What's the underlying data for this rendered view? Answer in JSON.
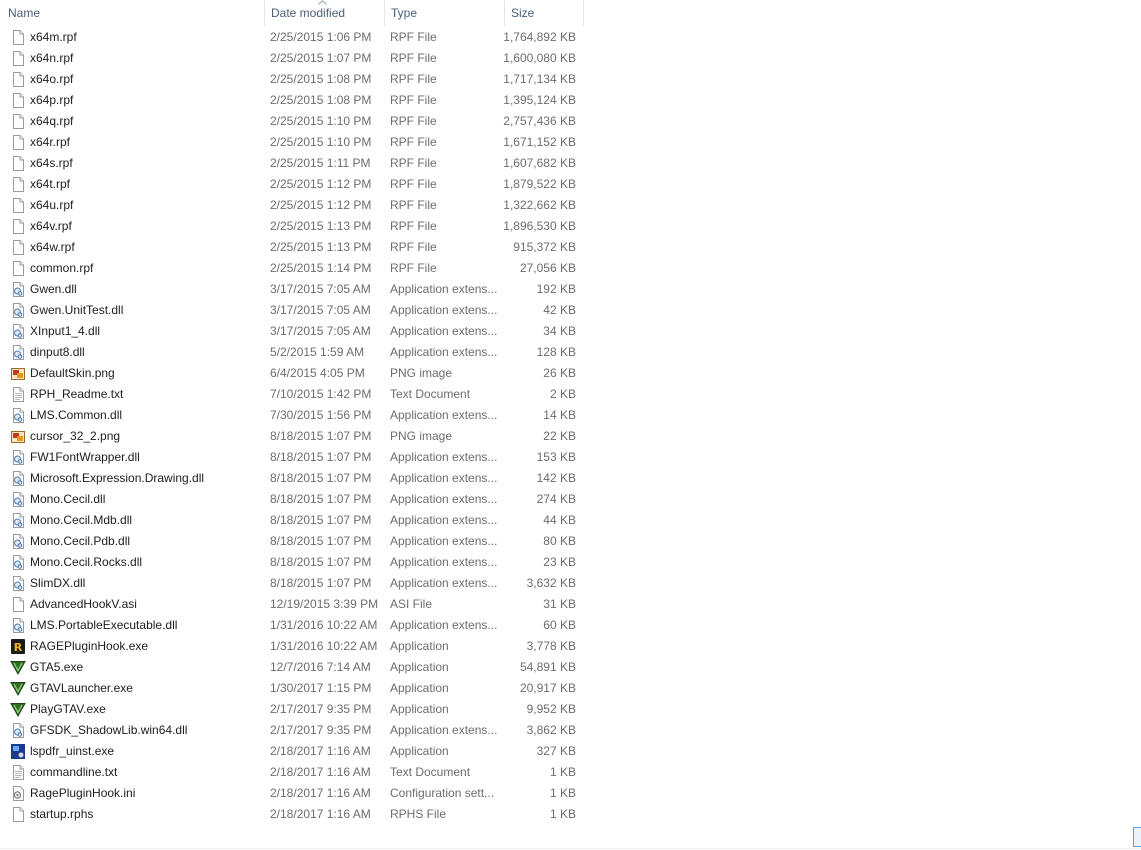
{
  "columns": {
    "name": "Name",
    "date": "Date modified",
    "type": "Type",
    "size": "Size"
  },
  "files": [
    {
      "name": "x64m.rpf",
      "date": "2/25/2015 1:06 PM",
      "type": "RPF File",
      "size": "1,764,892 KB",
      "icon": "file-icon"
    },
    {
      "name": "x64n.rpf",
      "date": "2/25/2015 1:07 PM",
      "type": "RPF File",
      "size": "1,600,080 KB",
      "icon": "file-icon"
    },
    {
      "name": "x64o.rpf",
      "date": "2/25/2015 1:08 PM",
      "type": "RPF File",
      "size": "1,717,134 KB",
      "icon": "file-icon"
    },
    {
      "name": "x64p.rpf",
      "date": "2/25/2015 1:08 PM",
      "type": "RPF File",
      "size": "1,395,124 KB",
      "icon": "file-icon"
    },
    {
      "name": "x64q.rpf",
      "date": "2/25/2015 1:10 PM",
      "type": "RPF File",
      "size": "2,757,436 KB",
      "icon": "file-icon"
    },
    {
      "name": "x64r.rpf",
      "date": "2/25/2015 1:10 PM",
      "type": "RPF File",
      "size": "1,671,152 KB",
      "icon": "file-icon"
    },
    {
      "name": "x64s.rpf",
      "date": "2/25/2015 1:11 PM",
      "type": "RPF File",
      "size": "1,607,682 KB",
      "icon": "file-icon"
    },
    {
      "name": "x64t.rpf",
      "date": "2/25/2015 1:12 PM",
      "type": "RPF File",
      "size": "1,879,522 KB",
      "icon": "file-icon"
    },
    {
      "name": "x64u.rpf",
      "date": "2/25/2015 1:12 PM",
      "type": "RPF File",
      "size": "1,322,662 KB",
      "icon": "file-icon"
    },
    {
      "name": "x64v.rpf",
      "date": "2/25/2015 1:13 PM",
      "type": "RPF File",
      "size": "1,896,530 KB",
      "icon": "file-icon"
    },
    {
      "name": "x64w.rpf",
      "date": "2/25/2015 1:13 PM",
      "type": "RPF File",
      "size": "915,372 KB",
      "icon": "file-icon"
    },
    {
      "name": "common.rpf",
      "date": "2/25/2015 1:14 PM",
      "type": "RPF File",
      "size": "27,056 KB",
      "icon": "file-icon"
    },
    {
      "name": "Gwen.dll",
      "date": "3/17/2015 7:05 AM",
      "type": "Application extens...",
      "size": "192 KB",
      "icon": "dll-icon"
    },
    {
      "name": "Gwen.UnitTest.dll",
      "date": "3/17/2015 7:05 AM",
      "type": "Application extens...",
      "size": "42 KB",
      "icon": "dll-icon"
    },
    {
      "name": "XInput1_4.dll",
      "date": "3/17/2015 7:05 AM",
      "type": "Application extens...",
      "size": "34 KB",
      "icon": "dll-icon"
    },
    {
      "name": "dinput8.dll",
      "date": "5/2/2015 1:59 AM",
      "type": "Application extens...",
      "size": "128 KB",
      "icon": "dll-icon"
    },
    {
      "name": "DefaultSkin.png",
      "date": "6/4/2015 4:05 PM",
      "type": "PNG image",
      "size": "26 KB",
      "icon": "png-icon"
    },
    {
      "name": "RPH_Readme.txt",
      "date": "7/10/2015 1:42 PM",
      "type": "Text Document",
      "size": "2 KB",
      "icon": "text-icon"
    },
    {
      "name": "LMS.Common.dll",
      "date": "7/30/2015 1:56 PM",
      "type": "Application extens...",
      "size": "14 KB",
      "icon": "dll-icon"
    },
    {
      "name": "cursor_32_2.png",
      "date": "8/18/2015 1:07 PM",
      "type": "PNG image",
      "size": "22 KB",
      "icon": "png-icon"
    },
    {
      "name": "FW1FontWrapper.dll",
      "date": "8/18/2015 1:07 PM",
      "type": "Application extens...",
      "size": "153 KB",
      "icon": "dll-icon"
    },
    {
      "name": "Microsoft.Expression.Drawing.dll",
      "date": "8/18/2015 1:07 PM",
      "type": "Application extens...",
      "size": "142 KB",
      "icon": "dll-icon"
    },
    {
      "name": "Mono.Cecil.dll",
      "date": "8/18/2015 1:07 PM",
      "type": "Application extens...",
      "size": "274 KB",
      "icon": "dll-icon"
    },
    {
      "name": "Mono.Cecil.Mdb.dll",
      "date": "8/18/2015 1:07 PM",
      "type": "Application extens...",
      "size": "44 KB",
      "icon": "dll-icon"
    },
    {
      "name": "Mono.Cecil.Pdb.dll",
      "date": "8/18/2015 1:07 PM",
      "type": "Application extens...",
      "size": "80 KB",
      "icon": "dll-icon"
    },
    {
      "name": "Mono.Cecil.Rocks.dll",
      "date": "8/18/2015 1:07 PM",
      "type": "Application extens...",
      "size": "23 KB",
      "icon": "dll-icon"
    },
    {
      "name": "SlimDX.dll",
      "date": "8/18/2015 1:07 PM",
      "type": "Application extens...",
      "size": "3,632 KB",
      "icon": "dll-icon"
    },
    {
      "name": "AdvancedHookV.asi",
      "date": "12/19/2015 3:39 PM",
      "type": "ASI File",
      "size": "31 KB",
      "icon": "file-icon"
    },
    {
      "name": "LMS.PortableExecutable.dll",
      "date": "1/31/2016 10:22 AM",
      "type": "Application extens...",
      "size": "60 KB",
      "icon": "dll-icon"
    },
    {
      "name": "RAGEPluginHook.exe",
      "date": "1/31/2016 10:22 AM",
      "type": "Application",
      "size": "3,778 KB",
      "icon": "rage-icon"
    },
    {
      "name": "GTA5.exe",
      "date": "12/7/2016 7:14 AM",
      "type": "Application",
      "size": "54,891 KB",
      "icon": "gtav-icon"
    },
    {
      "name": "GTAVLauncher.exe",
      "date": "1/30/2017 1:15 PM",
      "type": "Application",
      "size": "20,917 KB",
      "icon": "gtav-icon"
    },
    {
      "name": "PlayGTAV.exe",
      "date": "2/17/2017 9:35 PM",
      "type": "Application",
      "size": "9,952 KB",
      "icon": "gtav-icon"
    },
    {
      "name": "GFSDK_ShadowLib.win64.dll",
      "date": "2/17/2017 9:35 PM",
      "type": "Application extens...",
      "size": "3,862 KB",
      "icon": "dll-icon"
    },
    {
      "name": "lspdfr_uinst.exe",
      "date": "2/18/2017 1:16 AM",
      "type": "Application",
      "size": "327 KB",
      "icon": "uninstall-icon"
    },
    {
      "name": "commandline.txt",
      "date": "2/18/2017 1:16 AM",
      "type": "Text Document",
      "size": "1 KB",
      "icon": "text-icon"
    },
    {
      "name": "RagePluginHook.ini",
      "date": "2/18/2017 1:16 AM",
      "type": "Configuration sett...",
      "size": "1 KB",
      "icon": "config-icon"
    },
    {
      "name": "startup.rphs",
      "date": "2/18/2017 1:16 AM",
      "type": "RPHS File",
      "size": "1 KB",
      "icon": "file-icon"
    }
  ],
  "colors": {
    "header_text": "#4c607a",
    "name_text": "#1e1e1e",
    "detail_text": "#6d6d6d"
  }
}
